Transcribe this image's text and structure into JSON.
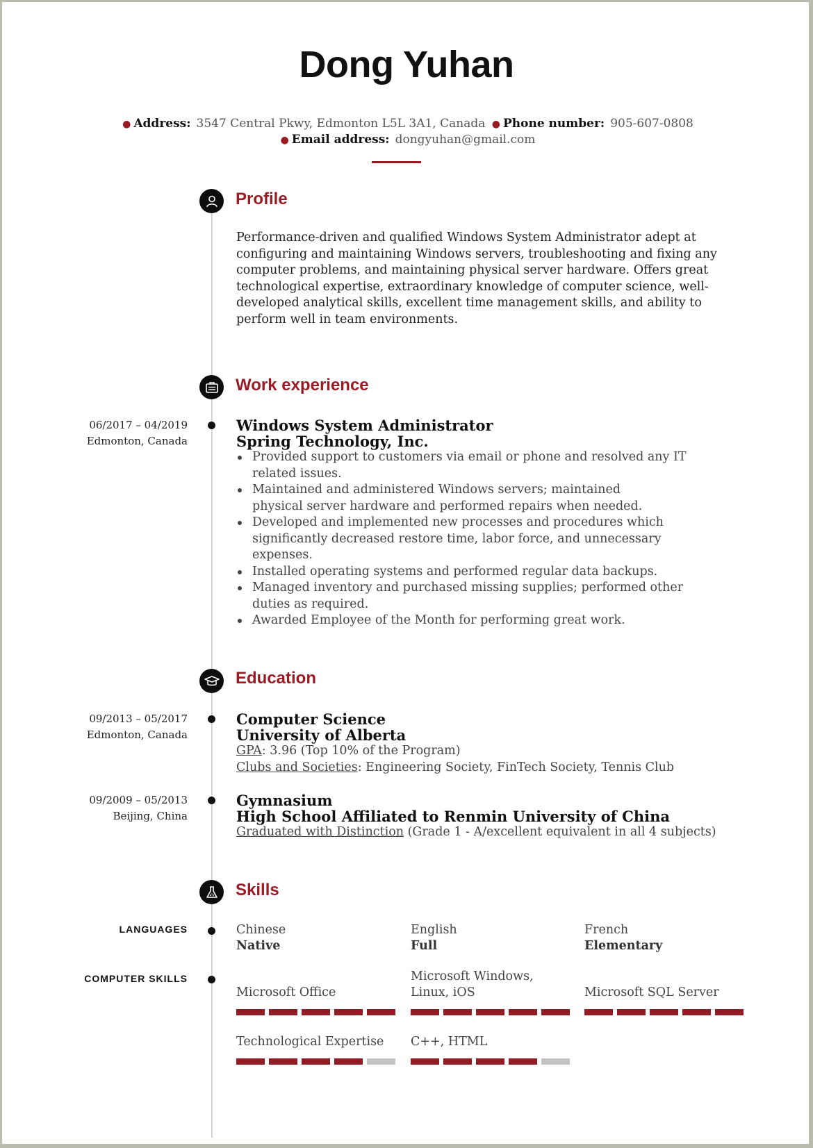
{
  "header": {
    "name": "Dong Yuhan",
    "contact": {
      "address_label": "Address:",
      "address": "3547 Central Pkwy, Edmonton L5L 3A1, Canada",
      "phone_label": "Phone number:",
      "phone": "905-607-0808",
      "email_label": "Email address:",
      "email": "dongyuhan@gmail.com"
    }
  },
  "colors": {
    "accent": "#9b1b25",
    "bar_filled": "#921c24",
    "bar_empty": "#c4c4c4",
    "timeline": "#d3d3d3"
  },
  "profile": {
    "title": "Profile",
    "icon": "user-icon",
    "lines": [
      "Performance-driven and qualified Windows System Administrator adept at",
      "configuring and maintaining Windows servers, troubleshooting and fixing any",
      "computer problems, and maintaining physical server hardware. Offers great",
      "technological expertise, extraordinary knowledge of computer science, well-",
      "developed analytical skills, excellent time management skills, and ability to",
      "perform well in team environments."
    ]
  },
  "work": {
    "title": "Work experience",
    "icon": "briefcase-icon",
    "entries": [
      {
        "dates": "06/2017 – 04/2019",
        "location": "Edmonton, Canada",
        "position": "Windows System Administrator",
        "company": "Spring Technology, Inc.",
        "bullets": [
          [
            "Provided support to customers via email or phone and resolved any IT",
            "related issues."
          ],
          [
            "Maintained and administered Windows servers; maintained",
            "physical server hardware and performed repairs when needed."
          ],
          [
            "Developed and implemented new processes and procedures which",
            "significantly decreased restore time, labor force, and unnecessary",
            "expenses."
          ],
          [
            "Installed operating systems and performed regular data backups."
          ],
          [
            "Managed inventory and purchased missing supplies; performed other",
            "duties as required."
          ],
          [
            "Awarded Employee of the Month for performing great work."
          ]
        ]
      }
    ]
  },
  "education": {
    "title": "Education",
    "icon": "graduation-cap-icon",
    "entries": [
      {
        "dates": "09/2013 – 05/2017",
        "location": "Edmonton, Canada",
        "degree": "Computer Science",
        "school": "University of Alberta",
        "details": [
          {
            "label": "GPA",
            "text": ": 3.96 (Top 10% of the Program)"
          },
          {
            "label": "Clubs and Societies",
            "text": ": Engineering Society, FinTech Society, Tennis Club"
          }
        ]
      },
      {
        "dates": "09/2009 – 05/2013",
        "location": "Beijing, China",
        "degree": "Gymnasium",
        "school": "High School Affiliated to Renmin University of China",
        "details": [
          {
            "label": "Graduated with Distinction",
            "text": " (Grade 1 - A/excellent equivalent in all 4 subjects)"
          }
        ]
      }
    ]
  },
  "skills": {
    "title": "Skills",
    "icon": "flask-icon",
    "languages_label": "LANGUAGES",
    "languages": [
      {
        "name": "Chinese",
        "level": "Native"
      },
      {
        "name": "English",
        "level": "Full"
      },
      {
        "name": "French",
        "level": "Elementary"
      }
    ],
    "computer_label": "COMPUTER SKILLS",
    "computer": [
      {
        "name": "Microsoft Office",
        "rating": 5,
        "max": 5
      },
      {
        "name": "Microsoft Windows,\nLinux, iOS",
        "rating": 5,
        "max": 5
      },
      {
        "name": "Microsoft SQL Server",
        "rating": 5,
        "max": 5
      },
      {
        "name": "Technological Expertise",
        "rating": 4,
        "max": 5
      },
      {
        "name": "C++, HTML",
        "rating": 4,
        "max": 5
      }
    ]
  }
}
